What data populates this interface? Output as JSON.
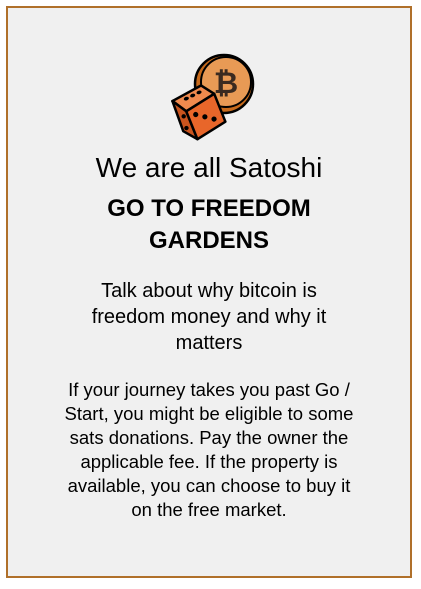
{
  "card": {
    "title": "We are all Satoshi",
    "subtitle": "GO TO FREEDOM GARDENS",
    "tagline": "Talk about why bitcoin is freedom money and why it matters",
    "body": "If your journey takes you past Go / Start, you might be eligible to some sats donations. Pay the owner the applicable fee. If the property is available, you can choose to buy it on the free market."
  },
  "logo": {
    "icon": "dice-and-bitcoin-icon",
    "coin_symbol": "₿"
  },
  "colors": {
    "border": "#b0702a",
    "background": "#f0f0f0",
    "dice": "#e8662a",
    "coin": "#e89a55"
  }
}
